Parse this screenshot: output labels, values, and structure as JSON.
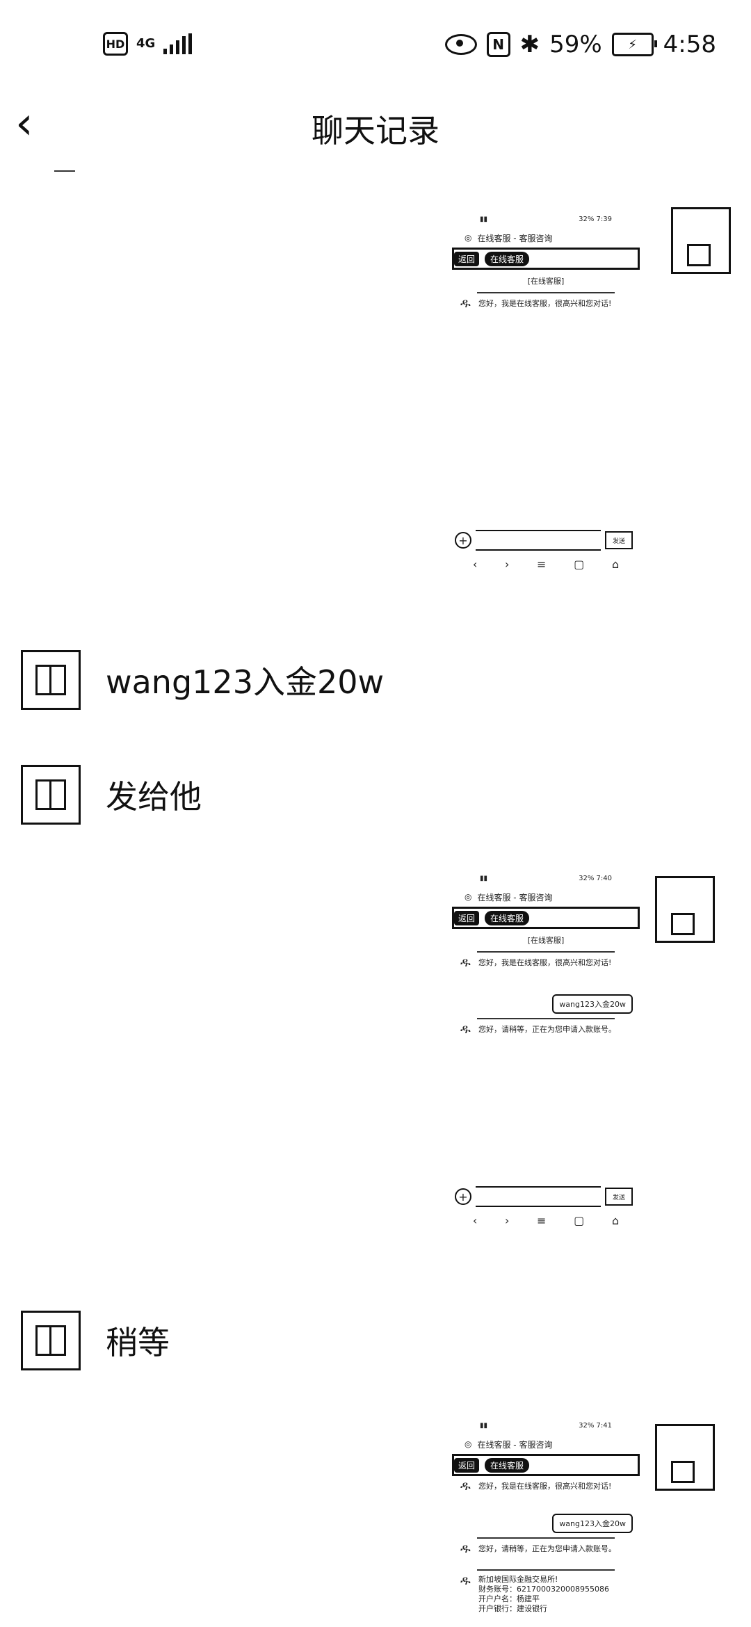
{
  "status_bar": {
    "hd": "HD",
    "network": "4G",
    "battery_percent": "59%",
    "time": "4:58",
    "nfc": "N"
  },
  "header": {
    "title": "聊天记录",
    "back_icon": "chevron-left-icon"
  },
  "screenshots": [
    {
      "status_time": "7:39",
      "battery": "32%",
      "topbar": "在线客服 - 客服咨询",
      "back_label": "返回",
      "tab_label": "在线客服",
      "sub_label": "[在线客服]",
      "messages": [
        "您好，我是在线客服，很高兴和您对话!"
      ],
      "send_label": "发送"
    },
    {
      "status_time": "7:40",
      "battery": "32%",
      "topbar": "在线客服 - 客服咨询",
      "back_label": "返回",
      "tab_label": "在线客服",
      "sub_label": "[在线客服]",
      "messages": [
        "您好，我是在线客服，很高兴和您对话!",
        "您好，请稍等，正在为您申请入款账号。"
      ],
      "user_bubble": "wang123入金20w",
      "send_label": "发送"
    },
    {
      "status_time": "7:41",
      "battery": "32%",
      "topbar": "在线客服 - 客服咨询",
      "back_label": "返回",
      "tab_label": "在线客服",
      "messages": [
        "您好，我是在线客服，很高兴和您对话!",
        "您好，请稍等，正在为您申请入款账号。"
      ],
      "user_bubble": "wang123入金20w",
      "account_lines": [
        "新加坡国际金融交易所!",
        "财务账号：6217000320008955086",
        "开户户名：杨建平",
        "开户银行：建设银行"
      ]
    }
  ],
  "left_messages": [
    {
      "text": "wang123入金20w"
    },
    {
      "text": "发给他"
    },
    {
      "text": "稍等"
    }
  ]
}
